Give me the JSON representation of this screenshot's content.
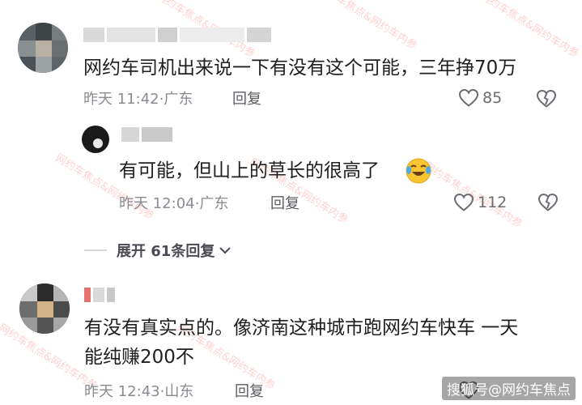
{
  "comments": [
    {
      "text_lines": [
        "网约车司机出来说一下有没有这个可能，三年挣70万"
      ],
      "time": "昨天 11:42",
      "location": "广东",
      "reply_label": "回复",
      "likes": "85"
    },
    {
      "text_lines": [
        "有可能，但山上的草长的很高了"
      ],
      "emoji": "laughing-tears-emoji",
      "time": "昨天 12:04",
      "location": "广东",
      "reply_label": "回复",
      "likes": "112"
    },
    {
      "text_lines": [
        "有没有真实点的。像济南这种城市跑网约车快车 一天",
        "能纯赚200不"
      ],
      "time": "昨天 12:43",
      "location": "山东",
      "reply_label": "回复"
    }
  ],
  "expand_replies": "展开 61条回复",
  "watermark": "网约车焦点&网约车内参",
  "brand": "搜狐号@网约车焦点",
  "colors": {
    "text": "#1f1f1f",
    "meta": "#8a8b91",
    "watermark": "#ff7878"
  }
}
